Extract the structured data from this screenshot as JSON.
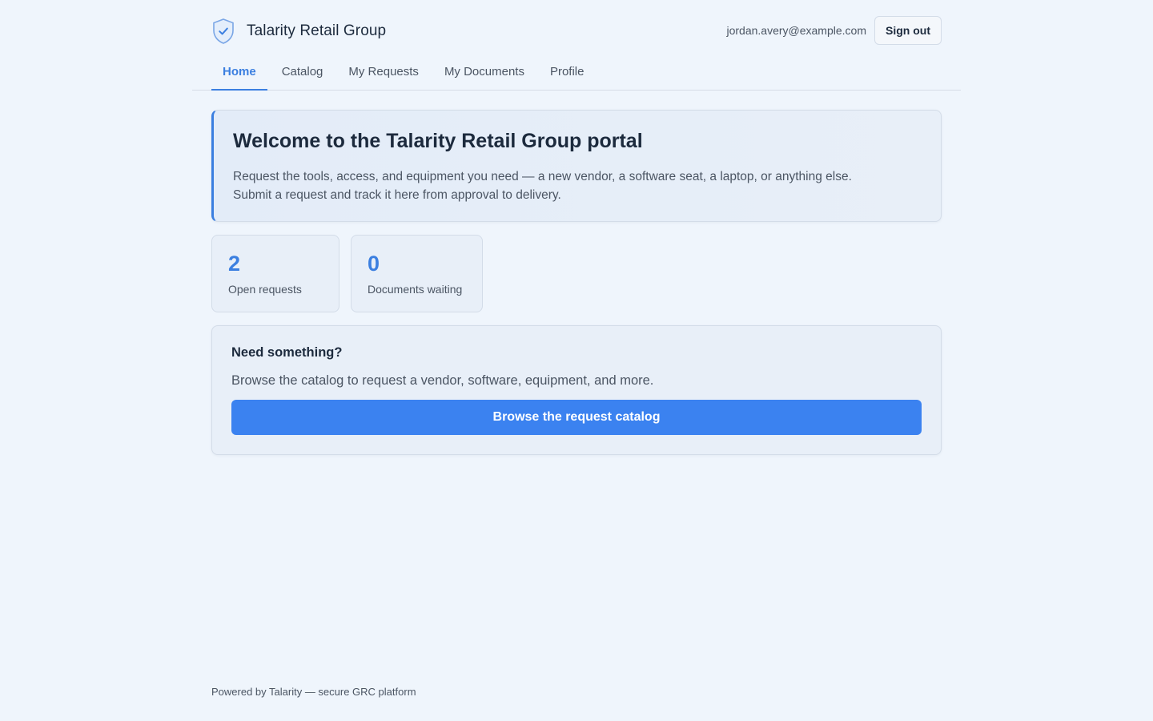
{
  "header": {
    "brand_name": "Talarity Retail Group",
    "logo_icon": "shield-check-icon",
    "user_email": "jordan.avery@example.com",
    "sign_out_label": "Sign out"
  },
  "nav": {
    "tabs": [
      {
        "label": "Home",
        "active": true
      },
      {
        "label": "Catalog",
        "active": false
      },
      {
        "label": "My Requests",
        "active": false
      },
      {
        "label": "My Documents",
        "active": false
      },
      {
        "label": "Profile",
        "active": false
      }
    ]
  },
  "welcome": {
    "title": "Welcome to the Talarity Retail Group portal",
    "line1": "Request the tools, access, and equipment you need — a new vendor, a software seat, a laptop, or anything else.",
    "line2": "Submit a request and track it here from approval to delivery."
  },
  "stats": [
    {
      "value": "2",
      "label": "Open requests"
    },
    {
      "value": "0",
      "label": "Documents waiting"
    }
  ],
  "cta": {
    "title": "Need something?",
    "text": "Browse the catalog to request a vendor, software, equipment, and more.",
    "button_label": "Browse the request catalog"
  },
  "footer": {
    "text": "Powered by Talarity — secure GRC platform"
  },
  "colors": {
    "accent": "#3b82f0",
    "background": "#eff5fc",
    "text": "#1c2a3d",
    "muted": "#4b5563"
  }
}
